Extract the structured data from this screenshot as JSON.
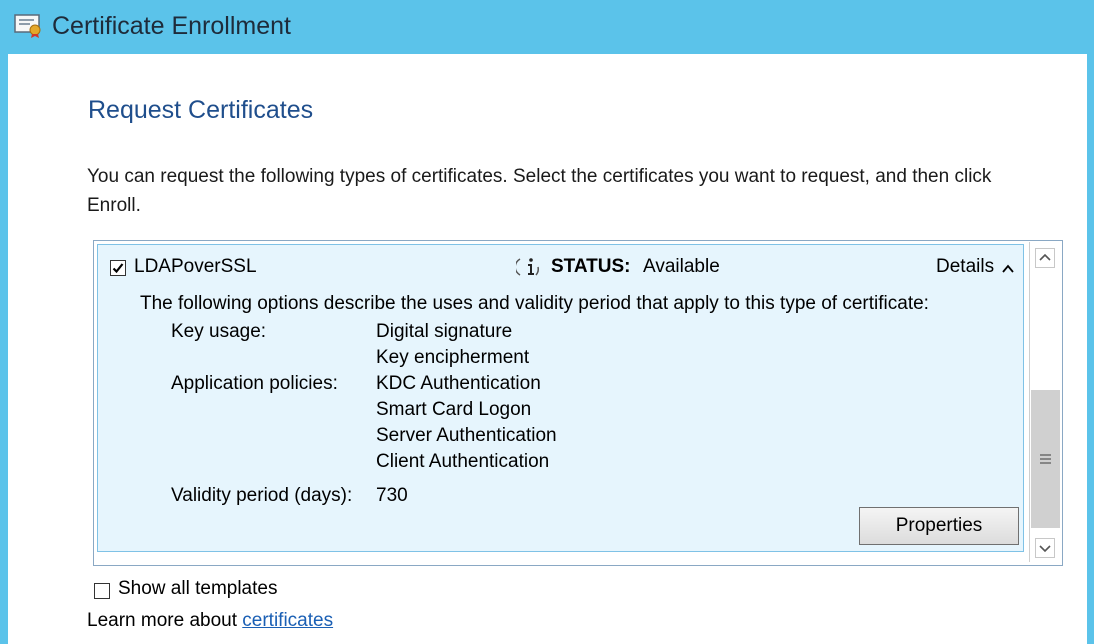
{
  "window": {
    "title": "Certificate Enrollment",
    "title_icon": "certificate-icon",
    "accent_color": "#5bc3ea"
  },
  "page": {
    "heading": "Request Certificates",
    "description": "You can request the following types of certificates. Select the certificates you want to request, and then click Enroll."
  },
  "certificate": {
    "name": "LDAPoverSSL",
    "checked": true,
    "status_label": "STATUS:",
    "status_value": "Available",
    "details_label": "Details",
    "details_expanded": true,
    "options_description": "The following options describe the uses and validity period that apply to this type of certificate:",
    "properties": [
      {
        "label": "Key usage:",
        "values": [
          "Digital signature",
          "Key encipherment"
        ]
      },
      {
        "label": "Application policies:",
        "values": [
          "KDC Authentication",
          "Smart Card Logon",
          "Server Authentication",
          "Client Authentication"
        ]
      },
      {
        "label": "Validity period (days):",
        "values": [
          "730"
        ]
      }
    ],
    "properties_button": "Properties"
  },
  "footer": {
    "show_all_label": "Show all templates",
    "show_all_checked": false,
    "learn_more_prefix": "Learn more about ",
    "learn_more_link": "certificates"
  }
}
